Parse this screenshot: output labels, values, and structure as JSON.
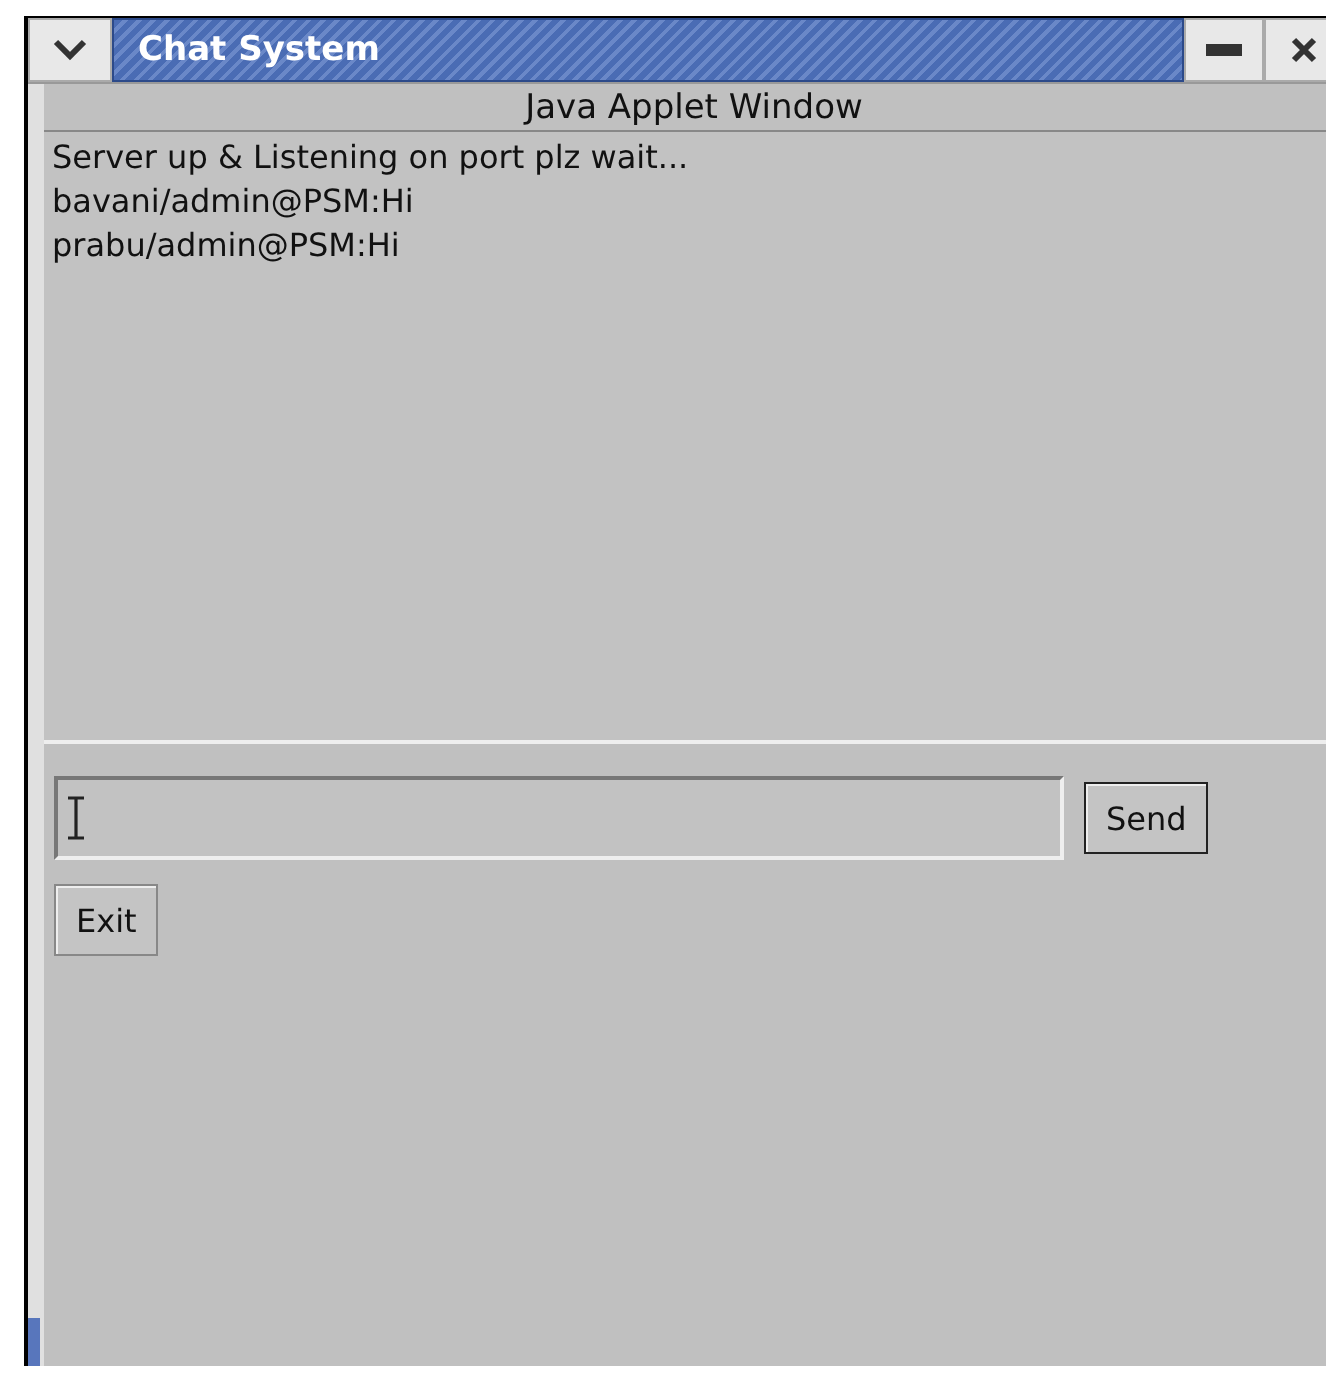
{
  "window": {
    "title": "Chat System",
    "banner": "Java Applet Window"
  },
  "messages": [
    "Server up & Listening on port plz wait...",
    "bavani/admin@PSM:Hi",
    "prabu/admin@PSM:Hi"
  ],
  "buttons": {
    "send": "Send",
    "exit": "Exit"
  }
}
